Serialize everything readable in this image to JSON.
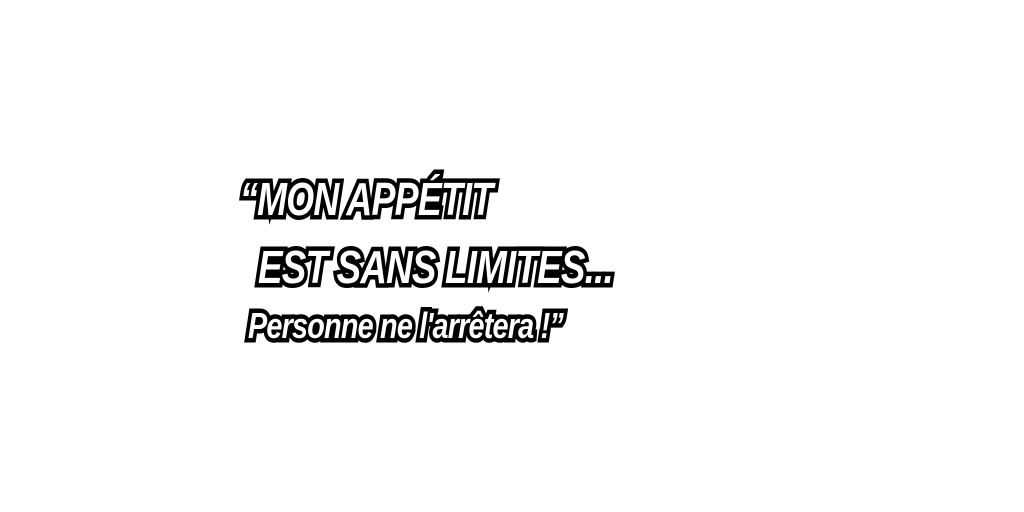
{
  "quote": {
    "line1": "“MON APPÉTIT",
    "line2": "EST SANS LIMITES...",
    "line3": "Personne ne l'arrêtera !”"
  },
  "colors": {
    "background": "#ffffff",
    "text_fill": "#ffffff",
    "text_outline": "#000000"
  }
}
